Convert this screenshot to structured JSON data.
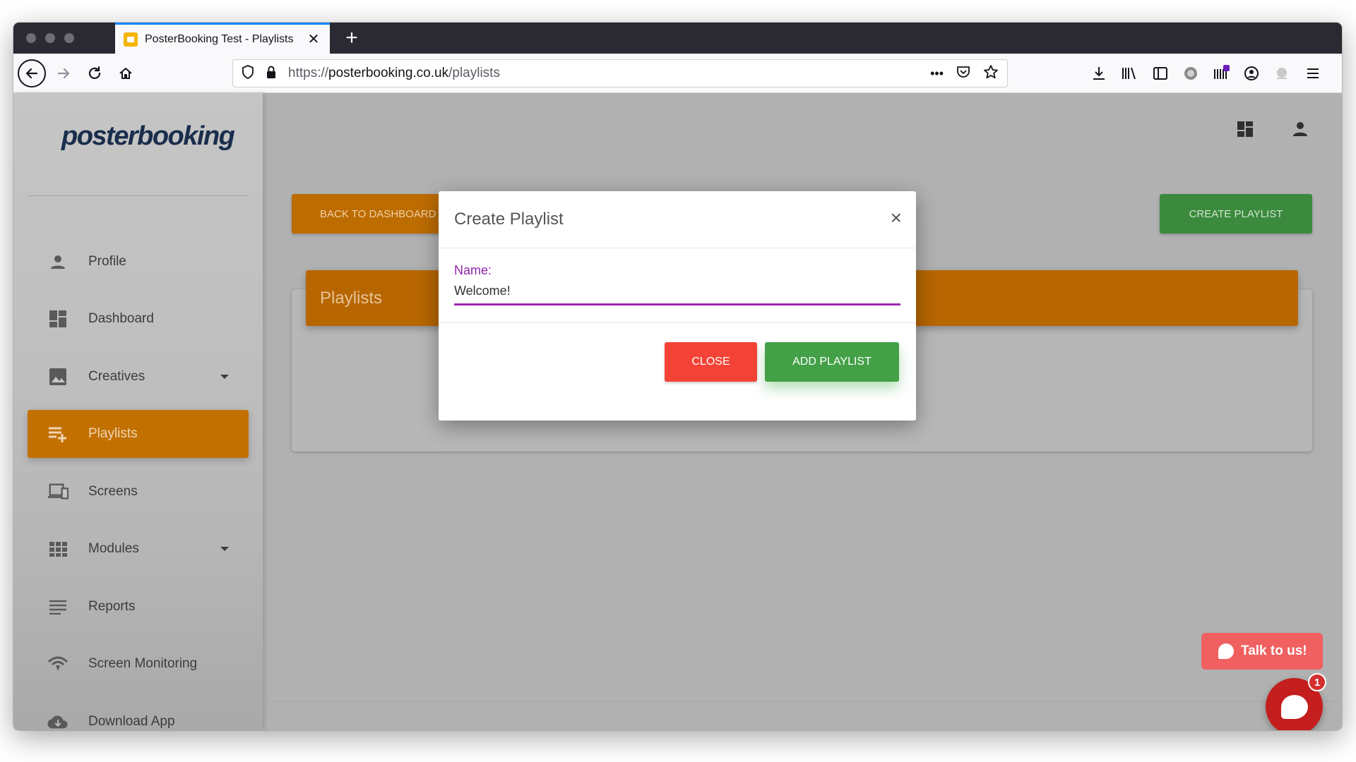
{
  "browser": {
    "tab_title": "PosterBooking Test - Playlists",
    "url_scheme": "https://",
    "url_domain": "posterbooking.co.uk",
    "url_path": "/playlists",
    "accent_color": "#0a84ff"
  },
  "app": {
    "logo_text": "posterbooking",
    "sidebar": {
      "items": [
        {
          "label": "Profile",
          "icon": "person-icon"
        },
        {
          "label": "Dashboard",
          "icon": "dashboard-icon"
        },
        {
          "label": "Creatives",
          "icon": "image-icon",
          "has_dropdown": true
        },
        {
          "label": "Playlists",
          "icon": "playlist-add-icon",
          "active": true
        },
        {
          "label": "Screens",
          "icon": "devices-icon"
        },
        {
          "label": "Modules",
          "icon": "apps-grid-icon",
          "has_dropdown": true
        },
        {
          "label": "Reports",
          "icon": "list-icon"
        },
        {
          "label": "Screen Monitoring",
          "icon": "wifi-signal-icon"
        },
        {
          "label": "Download App",
          "icon": "cloud-download-icon"
        }
      ]
    },
    "buttons": {
      "back_to_dashboard": "BACK TO DASHBOARD",
      "create_playlist": "CREATE PLAYLIST"
    },
    "card": {
      "title": "Playlists"
    },
    "colors": {
      "primary_orange": "#ff9800",
      "success_green": "#4caf50",
      "danger_red": "#f44336",
      "field_purple": "#9c27b0"
    }
  },
  "modal": {
    "title": "Create Playlist",
    "name_label": "Name:",
    "name_value": "Welcome!",
    "close_label": "CLOSE",
    "add_label": "ADD PLAYLIST"
  },
  "chat": {
    "talk_label": "Talk to us!",
    "badge_count": "1"
  }
}
